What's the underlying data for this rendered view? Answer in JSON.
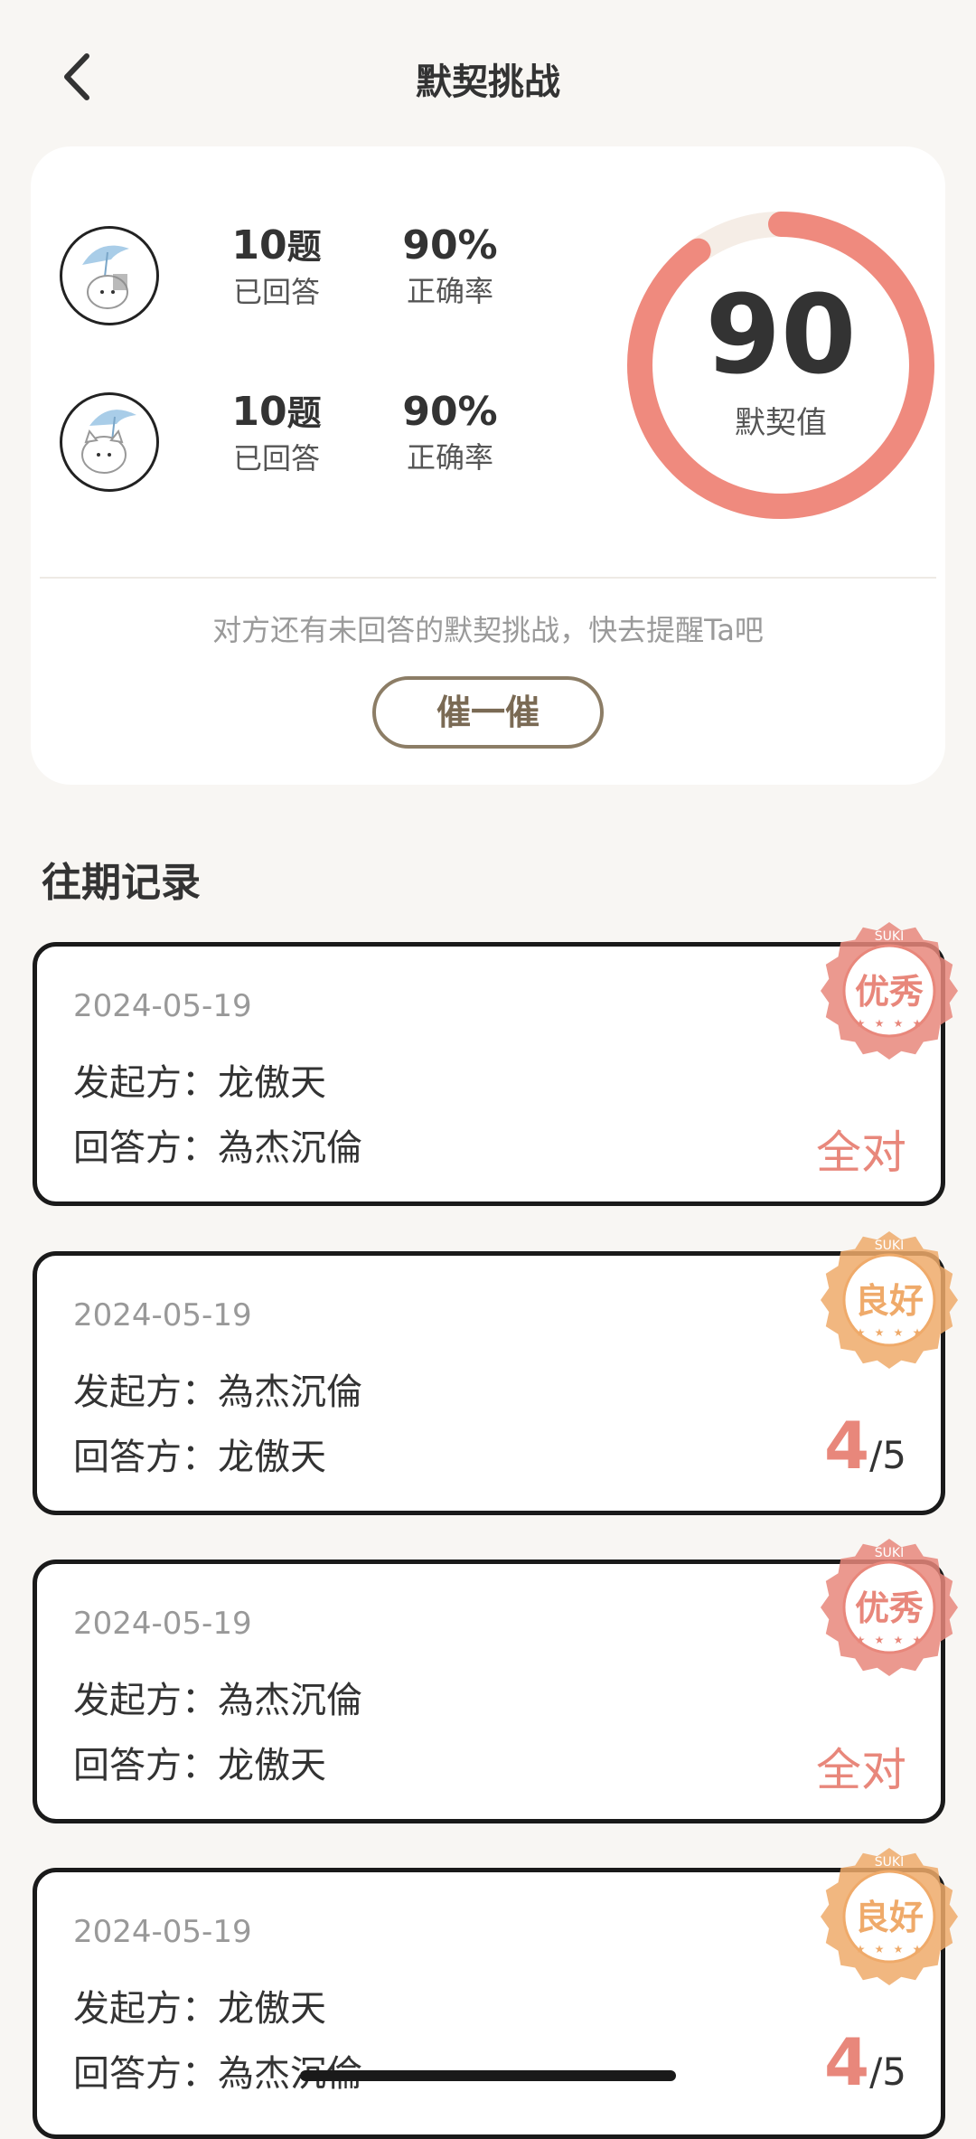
{
  "nav": {
    "title": "默契挑战"
  },
  "summary": {
    "users": [
      {
        "answered_num": "10",
        "answered_unit": "题",
        "answered_label": "已回答",
        "accuracy": "90%",
        "accuracy_label": "正确率"
      },
      {
        "answered_num": "10",
        "answered_unit": "题",
        "answered_label": "已回答",
        "accuracy": "90%",
        "accuracy_label": "正确率"
      }
    ],
    "score": "90",
    "score_label": "默契值",
    "score_percent": 90,
    "reminder_text": "对方还有未回答的默契挑战，快去提醒Ta吧",
    "nudge_label": "催一催"
  },
  "history": {
    "title": "往期记录",
    "records": [
      {
        "date": "2024-05-19",
        "initiator": "发起方：龙傲天",
        "responder": "回答方：為杰沉倫",
        "result": "全对",
        "stamp_text": "优秀",
        "stamp_color": "#e8877b"
      },
      {
        "date": "2024-05-19",
        "initiator": "发起方：為杰沉倫",
        "responder": "回答方：龙傲天",
        "score_num": "4",
        "score_total": "/5",
        "stamp_text": "良好",
        "stamp_color": "#efaa6a"
      },
      {
        "date": "2024-05-19",
        "initiator": "发起方：為杰沉倫",
        "responder": "回答方：龙傲天",
        "result": "全对",
        "stamp_text": "优秀",
        "stamp_color": "#e8877b"
      },
      {
        "date": "2024-05-19",
        "initiator": "发起方：龙傲天",
        "responder": "回答方：為杰沉倫",
        "score_num": "4",
        "score_total": "/5",
        "stamp_text": "良好",
        "stamp_color": "#efaa6a"
      }
    ],
    "stamp_arc_text": "SUKI"
  },
  "colors": {
    "ring_fill": "#ef8a7e",
    "ring_track": "#f5ede6",
    "accent": "#e8877b"
  }
}
